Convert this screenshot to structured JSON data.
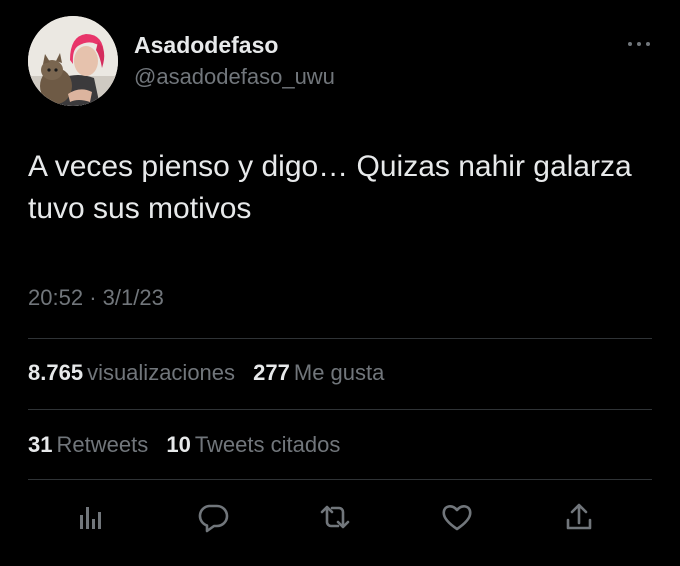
{
  "author": {
    "display_name": "Asadodefaso",
    "handle": "@asadodefaso_uwu",
    "avatar_icon": "user-avatar"
  },
  "tweet": {
    "text": "A veces pienso y digo… Quizas nahir galarza tuvo sus motivos",
    "time": "20:52",
    "separator": "·",
    "date": "3/1/23"
  },
  "stats": {
    "views_count": "8.765",
    "views_label": "visualizaciones",
    "likes_count": "277",
    "likes_label": "Me gusta",
    "retweets_count": "31",
    "retweets_label": "Retweets",
    "quotes_count": "10",
    "quotes_label": "Tweets citados"
  },
  "icons": {
    "more": "more-horizontal-icon",
    "analytics": "analytics-icon",
    "reply": "reply-icon",
    "retweet": "retweet-icon",
    "like": "like-icon",
    "share": "share-icon"
  },
  "colors": {
    "background": "#000000",
    "text_primary": "#e7e9ea",
    "text_secondary": "#71767b",
    "divider": "#2f3336",
    "avatar_hair": "#e8356a"
  }
}
